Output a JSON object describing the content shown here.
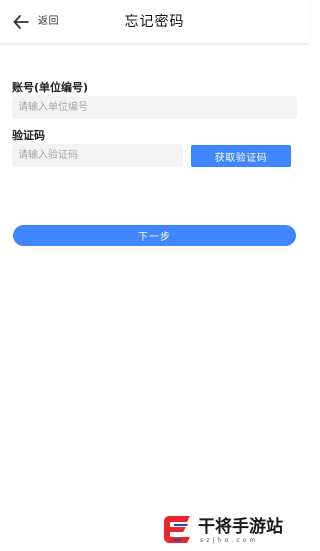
{
  "header": {
    "back_label": "返回",
    "title": "忘记密码"
  },
  "form": {
    "account_label": "账号(单位编号)",
    "account_placeholder": "请输入单位编号",
    "account_value": "",
    "code_label": "验证码",
    "code_placeholder": "请输入验证码",
    "code_value": "",
    "get_code_button": "获取验证码",
    "next_button": "下一步"
  },
  "watermark": {
    "brand": "干将手游站",
    "domain": "szjho.com"
  },
  "colors": {
    "accent": "#3f86ff",
    "input_bg": "#f3f3f3",
    "logo_red": "#e8262c",
    "logo_blue": "#1e4fa8"
  },
  "icons": {
    "back": "arrow-left-icon",
    "logo": "site-logo-icon"
  }
}
